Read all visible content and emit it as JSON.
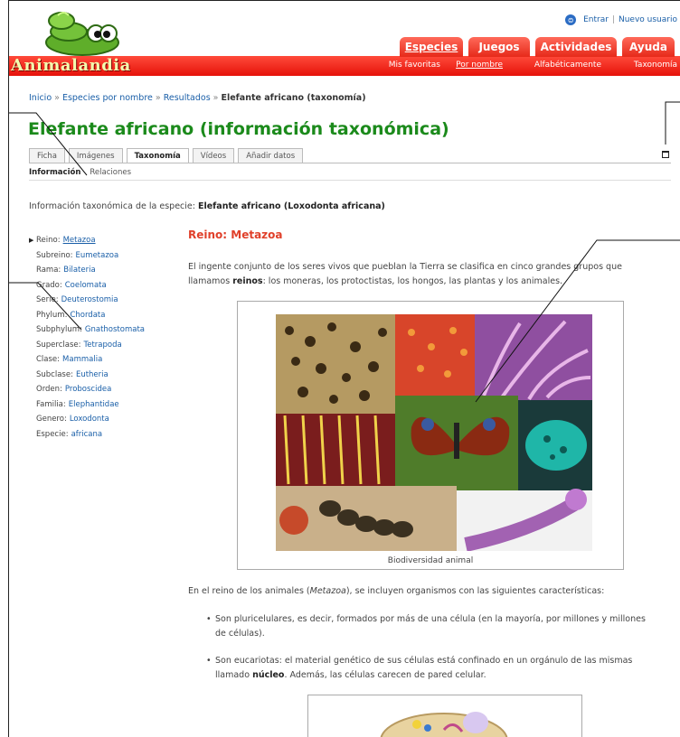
{
  "site": {
    "logo_text": "Animalandia"
  },
  "login": {
    "enter": "Entrar",
    "sep": "|",
    "register": "Nuevo usuario"
  },
  "main_nav": [
    {
      "label": "Especies"
    },
    {
      "label": "Juegos"
    },
    {
      "label": "Actividades"
    },
    {
      "label": "Ayuda"
    }
  ],
  "sub_nav": [
    {
      "label": "Mis favoritas"
    },
    {
      "label": "Por nombre"
    },
    {
      "label": "Alfabéticamente"
    },
    {
      "label": "Taxonomía"
    }
  ],
  "breadcrumb": {
    "items": [
      "Inicio",
      "Especies por nombre",
      "Resultados"
    ],
    "sep": "»",
    "current": "Elefante africano (taxonomía)"
  },
  "page_title": "Elefante africano (información taxonómica)",
  "content_tabs": [
    "Ficha",
    "Imágenes",
    "Taxonomía",
    "Vídeos",
    "Añadir datos"
  ],
  "sub_tabs": [
    "Información",
    "Relaciones"
  ],
  "intro": {
    "label": "Información taxonómica de la especie:",
    "species": "Elefante africano (Loxodonta africana)"
  },
  "taxonomy": [
    {
      "rank": "Reino:",
      "value": "Metazoa"
    },
    {
      "rank": "Subreino:",
      "value": "Eumetazoa"
    },
    {
      "rank": "Rama:",
      "value": "Bilateria"
    },
    {
      "rank": "Grado:",
      "value": "Coelomata"
    },
    {
      "rank": "Serie:",
      "value": "Deuterostomia"
    },
    {
      "rank": "Phylum:",
      "value": "Chordata"
    },
    {
      "rank": "Subphylum:",
      "value": "Gnathostomata"
    },
    {
      "rank": "Superclase:",
      "value": "Tetrapoda"
    },
    {
      "rank": "Clase:",
      "value": "Mammalia"
    },
    {
      "rank": "Subclase:",
      "value": "Eutheria"
    },
    {
      "rank": "Orden:",
      "value": "Proboscidea"
    },
    {
      "rank": "Familia:",
      "value": "Elephantidae"
    },
    {
      "rank": "Genero:",
      "value": "Loxodonta"
    },
    {
      "rank": "Especie:",
      "value": "africana"
    }
  ],
  "section": {
    "title": "Reino: Metazoa",
    "para1_a": "El ingente conjunto de los seres vivos que pueblan la Tierra se clasifica en cinco grandes grupos que llamamos",
    "para1_bold": "reinos",
    "para1_b": ": los moneras, los protoctistas, los hongos, las plantas y los animales.",
    "figure_caption": "Biodiversidad animal",
    "para2_a": "En el reino de los animales (",
    "para2_italic": "Metazoa",
    "para2_b": "), se incluyen organismos con las siguientes características:",
    "bullet1": "Son pluricelulares, es decir, formados por más de una célula (en la mayoría, por millones y millones de células).",
    "bullet2_a": "Son eucariotas: el material genético de sus células está confinado en un orgánulo de las mismas llamado",
    "bullet2_bold": "núcleo",
    "bullet2_b": ". Además, las células carecen de pared celular."
  },
  "colors": {
    "red": "#e5120a",
    "title_green": "#1b8a1b",
    "section_red": "#e0402a",
    "link_blue": "#1a5fa8"
  }
}
